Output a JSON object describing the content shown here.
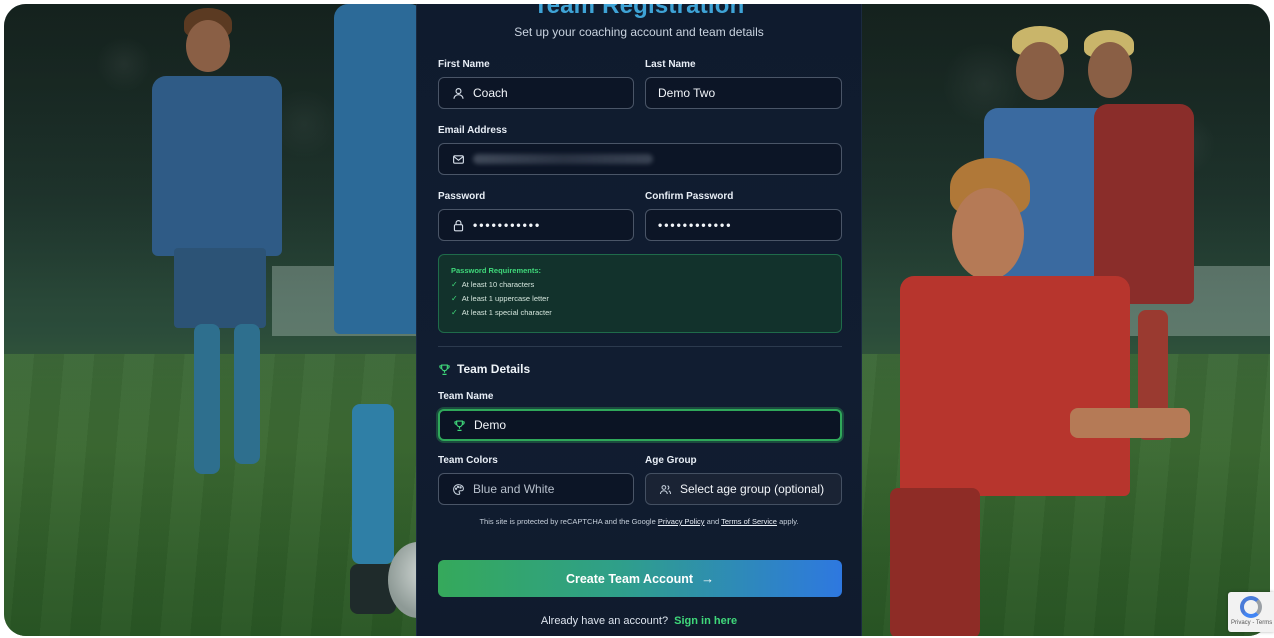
{
  "form": {
    "title": "Team Registration",
    "subtitle": "Set up your coaching account and team details",
    "first_name": {
      "label": "First Name",
      "value": "Coach",
      "icon": "user-icon"
    },
    "last_name": {
      "label": "Last Name",
      "value": "Demo Two"
    },
    "email": {
      "label": "Email Address",
      "icon": "mail-icon"
    },
    "password": {
      "label": "Password",
      "masked": "•••••••••••",
      "icon": "lock-icon"
    },
    "confirm_password": {
      "label": "Confirm Password",
      "masked": "••••••••••••"
    },
    "requirements": {
      "title": "Password Requirements:",
      "items": [
        "At least 10 characters",
        "At least 1 uppercase letter",
        "At least 1 special character"
      ],
      "check": "✓"
    },
    "team_section": {
      "title": "Team Details",
      "icon": "trophy-icon"
    },
    "team_name": {
      "label": "Team Name",
      "value": "Demo",
      "icon": "trophy-icon"
    },
    "team_colors": {
      "label": "Team Colors",
      "placeholder": "Blue and White",
      "icon": "palette-icon"
    },
    "age_group": {
      "label": "Age Group",
      "selected": "Select age group (optional)",
      "icon": "users-icon"
    },
    "captcha": {
      "prefix": "This site is protected by reCAPTCHA and the Google",
      "privacy": "Privacy Policy",
      "and": "and",
      "terms": "Terms of Service",
      "suffix": "apply."
    },
    "submit_label": "Create Team Account",
    "submit_arrow": "→",
    "signin_prompt": "Already have an account?",
    "signin_link": "Sign in here"
  },
  "recaptcha_badge": "Privacy - Terms",
  "colors": {
    "accent_green": "#3fd87a",
    "title_blue": "#3ea3d6",
    "panel_bg": "#0f1b2e",
    "cta_start": "#35a95b",
    "cta_end": "#2e78e0"
  }
}
